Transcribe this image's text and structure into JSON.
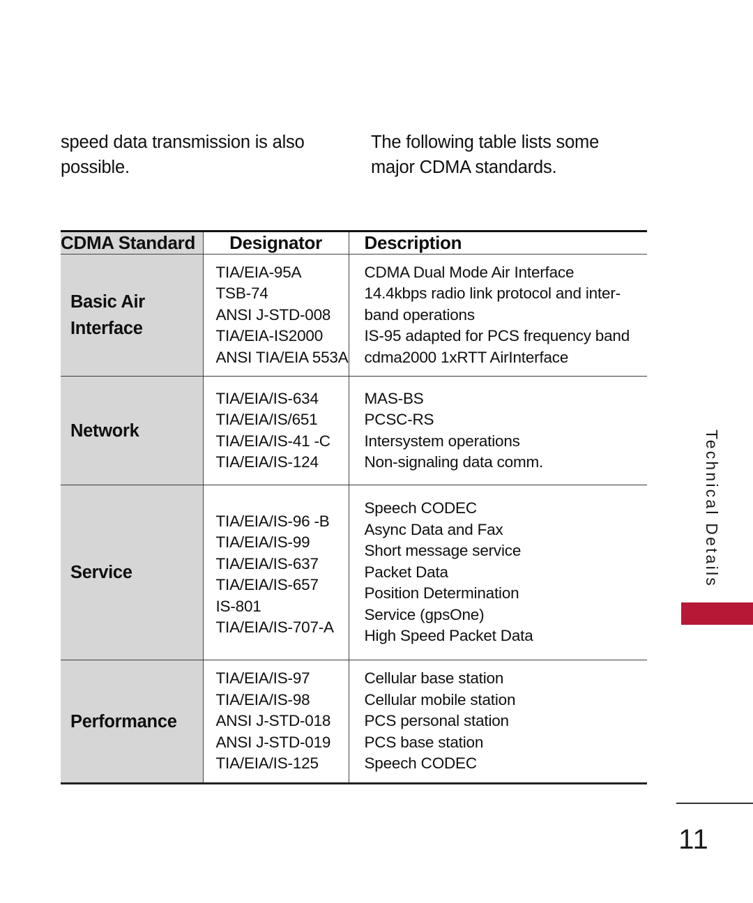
{
  "intro": {
    "left_column": [
      "speed data transmission is also",
      "possible."
    ],
    "right_column": [
      "The following table lists some",
      "major CDMA standards."
    ]
  },
  "table": {
    "headers": {
      "standard": "CDMA Standard",
      "designator": "Designator",
      "description": "Description"
    },
    "rows": [
      {
        "category": [
          "Basic Air",
          "Interface"
        ],
        "designators": [
          "TIA/EIA-95A",
          "TSB-74",
          "ANSI J-STD-008",
          "TIA/EIA-IS2000",
          "ANSI TIA/EIA 553A"
        ],
        "descriptions": [
          "CDMA Dual Mode Air Interface",
          "14.4kbps radio link protocol and inter-",
          "band operations",
          "IS-95 adapted for PCS frequency band",
          "cdma2000 1xRTT AirInterface"
        ]
      },
      {
        "category": [
          "Network"
        ],
        "designators": [
          "TIA/EIA/IS-634",
          "TIA/EIA/IS/651",
          "TIA/EIA/IS-41 -C",
          "TIA/EIA/IS-124"
        ],
        "descriptions": [
          "MAS-BS",
          "PCSC-RS",
          "Intersystem operations",
          "Non-signaling data comm."
        ]
      },
      {
        "category": [
          "Service"
        ],
        "designators": [
          "TIA/EIA/IS-96 -B",
          "TIA/EIA/IS-99",
          "TIA/EIA/IS-637",
          "TIA/EIA/IS-657",
          "IS-801",
          "TIA/EIA/IS-707-A"
        ],
        "descriptions": [
          "Speech CODEC",
          "Async Data and Fax",
          "Short message service",
          "Packet Data",
          "Position Determination",
          "Service (gpsOne)",
          "High Speed Packet Data"
        ]
      },
      {
        "category": [
          "Performance"
        ],
        "designators": [
          "TIA/EIA/IS-97",
          "TIA/EIA/IS-98",
          "ANSI J-STD-018",
          "ANSI J-STD-019",
          "TIA/EIA/IS-125"
        ],
        "descriptions": [
          "Cellular base station",
          "Cellular mobile station",
          "PCS personal station",
          "PCS base station",
          "Speech CODEC"
        ]
      }
    ]
  },
  "side_tab": {
    "label": "Technical Details",
    "color": "#b51936"
  },
  "footer": {
    "page_number": "11"
  }
}
